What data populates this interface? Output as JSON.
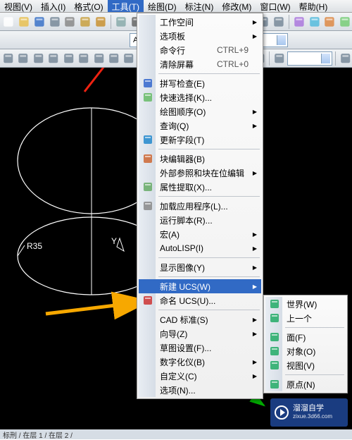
{
  "menubar": [
    {
      "label": "视图(V)"
    },
    {
      "label": "插入(I)"
    },
    {
      "label": "格式(O)"
    },
    {
      "label": "工具(T)",
      "active": true
    },
    {
      "label": "绘图(D)"
    },
    {
      "label": "标注(N)"
    },
    {
      "label": "修改(M)"
    },
    {
      "label": "窗口(W)"
    },
    {
      "label": "帮助(H)"
    }
  ],
  "toolbar_rows": [
    [
      "new-doc",
      "open",
      "save",
      "blank",
      "cut",
      "copy",
      "paste",
      "sep",
      "cloud",
      "print",
      "find",
      "sep",
      "undo",
      "redo",
      "sep",
      "pan",
      "zoom",
      "sep",
      "help",
      "sep",
      "dim1",
      "dim2",
      "sep",
      "palette",
      "layers",
      "paint",
      "xref"
    ],
    [
      "spacer",
      "combo-A4",
      "sep",
      "layer-group",
      "sep",
      "filter",
      "sep",
      "thick",
      "combo-empty"
    ],
    [
      "line",
      "circle",
      "arc",
      "rect",
      "spline",
      "poly",
      "hatch",
      "ellipse",
      "fillet",
      "sep",
      "explode",
      "mirror",
      "offset",
      "array",
      "trim",
      "extend",
      "sep",
      "rotate",
      "scale",
      "sep",
      "ucs-icon",
      "combo-empty2",
      "sep",
      "measure"
    ]
  ],
  "tools_menu": {
    "groups": [
      [
        {
          "label": "工作空间",
          "sub": true
        },
        {
          "label": "选项板",
          "sub": true
        },
        {
          "label": "命令行",
          "shortcut": "CTRL+9"
        },
        {
          "label": "清除屏幕",
          "shortcut": "CTRL+0"
        }
      ],
      [
        {
          "label": "拼写检查(E)",
          "icon": "abc"
        },
        {
          "label": "快速选择(K)...",
          "icon": "sel"
        },
        {
          "label": "绘图顺序(O)",
          "sub": true
        },
        {
          "label": "查询(Q)",
          "sub": true
        },
        {
          "label": "更新字段(T)",
          "icon": "refresh"
        }
      ],
      [
        {
          "label": "块编辑器(B)",
          "icon": "block"
        },
        {
          "label": "外部参照和块在位编辑",
          "sub": true
        },
        {
          "label": "属性提取(X)...",
          "icon": "attr"
        }
      ],
      [
        {
          "label": "加载应用程序(L)...",
          "icon": "load"
        },
        {
          "label": "运行脚本(R)..."
        },
        {
          "label": "宏(A)",
          "sub": true
        },
        {
          "label": "AutoLISP(I)",
          "sub": true
        }
      ],
      [
        {
          "label": "显示图像(Y)",
          "sub": true
        }
      ],
      [
        {
          "label": "新建 UCS(W)",
          "sub": true,
          "hl": true
        },
        {
          "label": "命名 UCS(U)...",
          "icon": "ucs"
        }
      ],
      [
        {
          "label": "CAD 标准(S)",
          "sub": true
        },
        {
          "label": "向导(Z)",
          "sub": true
        },
        {
          "label": "草图设置(F)..."
        },
        {
          "label": "数字化仪(B)",
          "sub": true
        },
        {
          "label": "自定义(C)",
          "sub": true
        },
        {
          "label": "选项(N)..."
        }
      ]
    ]
  },
  "ucs_submenu": [
    {
      "label": "世界(W)",
      "icon": "world"
    },
    {
      "label": "上一个",
      "icon": "prev"
    },
    "sep",
    {
      "label": "面(F)",
      "icon": "face"
    },
    {
      "label": "对象(O)",
      "icon": "obj"
    },
    {
      "label": "视图(V)",
      "icon": "view"
    },
    "sep",
    {
      "label": "原点(N)",
      "icon": "origin"
    }
  ],
  "canvas_text": {
    "r35": "R35",
    "y": "Y"
  },
  "watermark": {
    "line1": "溜溜自学",
    "line2": "zixue.3d66.com"
  },
  "status": "标刑 / 在层 1 / 在层 2 /"
}
